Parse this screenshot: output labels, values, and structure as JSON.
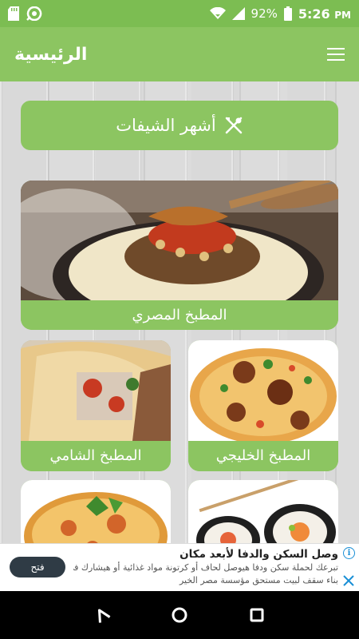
{
  "status_bar": {
    "battery": "92%",
    "time": "5:26",
    "ampm": "PM",
    "icons": [
      "sd-card-icon",
      "notification-app-icon",
      "wifi-icon",
      "signal-icon",
      "battery-icon"
    ]
  },
  "app_bar": {
    "title": "الرئيسية",
    "menu_icon": "menu-icon"
  },
  "popular_button": {
    "label": "أشهر الشيفات",
    "icon": "cutlery-icon"
  },
  "cuisines": [
    {
      "label": "المطبخ المصري",
      "image": "egyptian-koshari-image"
    },
    {
      "label": "المطبخ الخليجي",
      "image": "gulf-biryani-image"
    },
    {
      "label": "المطبخ الشامي",
      "image": "levant-shawarma-image"
    },
    {
      "label": "",
      "image": "sushi-image"
    },
    {
      "label": "",
      "image": "pizza-image"
    }
  ],
  "ad": {
    "title": "وصل السكن والدفا لأبعد مكان",
    "line1": "تبرعك لحملة سكن ودفا هيوصل لحاف أو كرتونة مواد غذائية أو هيشارك في",
    "line2": "بناء سقف لبيت مستحق مؤسسة مصر الخير",
    "button": "فتح",
    "info_icon": "i"
  },
  "colors": {
    "primary": "#8cc561",
    "status": "#7cbd52",
    "ad_button": "#2f3b45",
    "info": "#1a8fd6"
  }
}
